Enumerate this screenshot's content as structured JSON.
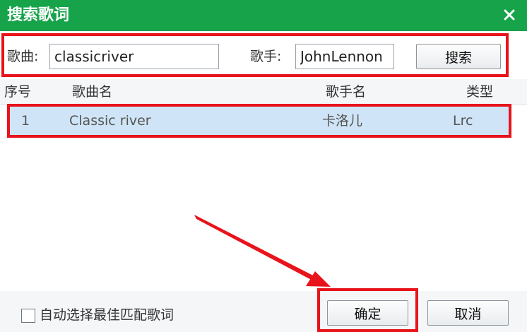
{
  "window": {
    "title": "搜索歌词",
    "close_icon": "close-icon"
  },
  "search": {
    "song_label": "歌曲:",
    "song_value": "classicriver",
    "artist_label": "歌手:",
    "artist_value": "JohnLennon",
    "search_button": "搜索"
  },
  "table": {
    "columns": [
      "序号",
      "歌曲名",
      "歌手名",
      "类型"
    ],
    "rows": [
      {
        "index": "1",
        "song": "Classic river",
        "artist": "卡洛儿",
        "type": "Lrc"
      }
    ]
  },
  "footer": {
    "auto_select_label": "自动选择最佳匹配歌词",
    "auto_select_checked": false,
    "ok_button": "确定",
    "cancel_button": "取消"
  },
  "colors": {
    "title_bar": "#16a34a",
    "highlight": "#e8131b",
    "selected_row": "#cfe5f7"
  }
}
